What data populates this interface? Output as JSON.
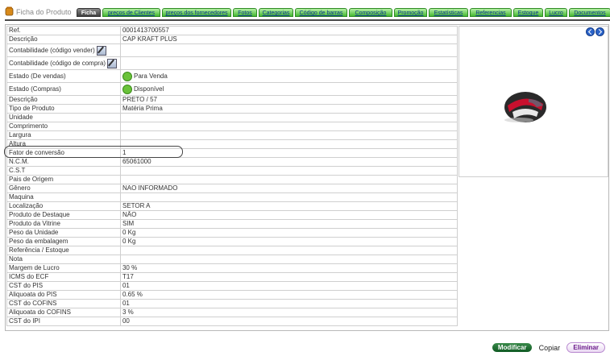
{
  "header": {
    "title": "Ficha do Produto",
    "icon": "product-jar-icon"
  },
  "tabs": [
    {
      "label": "Ficha",
      "active": true
    },
    {
      "label": "preços de Clientes"
    },
    {
      "label": "preços dos fornecedores"
    },
    {
      "label": "Fotos"
    },
    {
      "label": "Categorias"
    },
    {
      "label": "Código de barras"
    },
    {
      "label": "Composição"
    },
    {
      "label": "Promoção"
    },
    {
      "label": "Estatísticas"
    },
    {
      "label": "Referencias"
    },
    {
      "label": "Estoque"
    },
    {
      "label": "Lucro"
    },
    {
      "label": "Documentos"
    }
  ],
  "rows": [
    {
      "label": "Ref.",
      "value": "0001413700557"
    },
    {
      "label": "Descrição",
      "value": "CAP KRAFT PLUS"
    },
    {
      "label": "Contabilidade (código vender)",
      "value": "",
      "edit": true
    },
    {
      "label": "Contabilidade (código de compra)",
      "value": "",
      "edit": true
    },
    {
      "label": "Estado (De vendas)",
      "value": "Para Venda",
      "status": true
    },
    {
      "label": "Estado (Compras)",
      "value": "Disponível",
      "status": true
    },
    {
      "label": "Descrição",
      "value": "PRETO / 57"
    },
    {
      "label": "Tipo de Produto",
      "value": "Matéria Prima"
    },
    {
      "label": "Unidade",
      "value": ""
    },
    {
      "label": "Comprimento",
      "value": ""
    },
    {
      "label": "Largura",
      "value": ""
    },
    {
      "label": "Altura",
      "value": ""
    },
    {
      "label": "Fator de conversão",
      "value": "1"
    },
    {
      "label": "N.C.M.",
      "value": "65061000"
    },
    {
      "label": "C.S.T",
      "value": ""
    },
    {
      "label": "Pais de Origem",
      "value": ""
    },
    {
      "label": "Gênero",
      "value": "NAO INFORMADO"
    },
    {
      "label": "Maquina",
      "value": ""
    },
    {
      "label": "Localização",
      "value": "SETOR A"
    },
    {
      "label": "Produto de Destaque",
      "value": "NÃO"
    },
    {
      "label": "Produto da Vitrine",
      "value": "SIM"
    },
    {
      "label": "Peso da Unidade",
      "value": "0 Kg"
    },
    {
      "label": "Peso da embalagem",
      "value": "0 Kg"
    },
    {
      "label": "Referência / Estoque",
      "value": ""
    },
    {
      "label": "Nota",
      "value": ""
    },
    {
      "label": "Margem de Lucro",
      "value": "30 %"
    },
    {
      "label": "ICMS do ECF",
      "value": "T17"
    },
    {
      "label": "CST do PIS",
      "value": "01"
    },
    {
      "label": "Aliquoata do PIS",
      "value": "0.65 %"
    },
    {
      "label": "CST do COFINS",
      "value": "01"
    },
    {
      "label": "Aliquoata do COFINS",
      "value": "3 %"
    },
    {
      "label": "CST do IPI",
      "value": "00"
    }
  ],
  "image": {
    "icon": "helmet-product-image"
  },
  "footer": {
    "modify_label": "Modificar",
    "copy_label": "Copiar",
    "delete_label": "Eliminar"
  },
  "colors": {
    "tab_green": "#45b832",
    "tab_active": "#3f3f3f",
    "link_blue": "#0a3a8a",
    "modify_green": "#0f5a23",
    "delete_purple": "#6a1a8a"
  }
}
